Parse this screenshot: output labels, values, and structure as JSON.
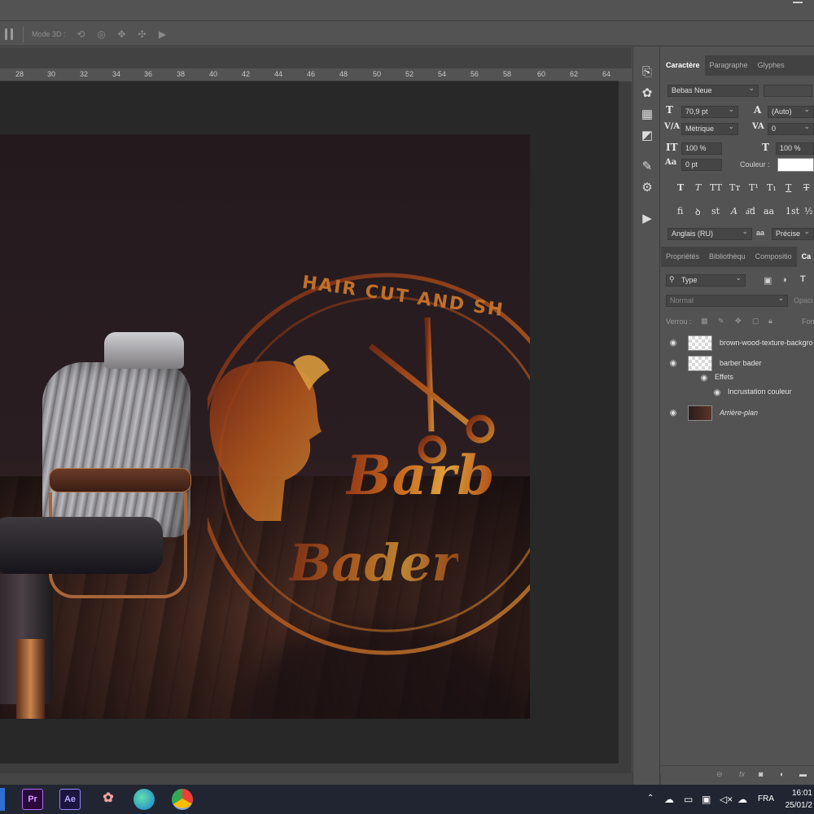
{
  "options_bar": {
    "mode3d_label": "Mode 3D :"
  },
  "ruler": {
    "ticks": [
      "28",
      "30",
      "32",
      "34",
      "36",
      "38",
      "40",
      "42",
      "44",
      "46",
      "48",
      "50",
      "52",
      "54",
      "56",
      "58",
      "60",
      "62",
      "64"
    ]
  },
  "canvas": {
    "logo_arc_text": "HAIR CUT AND SH",
    "logo_brand_line1": "Barb",
    "logo_brand_line2": "Bader"
  },
  "character_panel": {
    "tabs": [
      "Caractère",
      "Paragraphe",
      "Glyphes"
    ],
    "font_family": "Bebas Neue",
    "font_size": "70,9 pt",
    "leading": "(Auto)",
    "kerning": "Métrique",
    "tracking": "0",
    "vertical_scale": "100 %",
    "horizontal_scale": "100 %",
    "baseline_shift": "0 pt",
    "color_label": "Couleur :",
    "language": "Anglais (RU)",
    "antialias": "Précise",
    "aa_label": "aa"
  },
  "layers_panel": {
    "tabs": [
      "Propriétés",
      "Bibliothèqu",
      "Compositio",
      "Ca"
    ],
    "filter": "Type",
    "blend_mode": "Normal",
    "opacity_label": "Opaci",
    "lock_label": "Verrou :",
    "fill_label": "Fon",
    "layers": [
      {
        "name": "brown-wood-texture-backgro",
        "type": "transparent",
        "visible": true
      },
      {
        "name": "barber bader",
        "type": "smart",
        "visible": true
      },
      {
        "name": "Effets",
        "type": "effects",
        "visible": true
      },
      {
        "name": "Incrustation couleur",
        "type": "effect",
        "visible": true
      },
      {
        "name": "Arrière-plan",
        "type": "photo",
        "visible": true
      }
    ]
  },
  "taskbar": {
    "apps": [
      "Pr",
      "Ae"
    ],
    "language": "FRA",
    "time": "16:01",
    "date": "25/01/2"
  },
  "colors": {
    "panel_bg": "#535353",
    "doc_bg": "#282828",
    "taskbar_bg": "#202531",
    "premiere": "#9999ff",
    "after_effects": "#9999ff"
  }
}
